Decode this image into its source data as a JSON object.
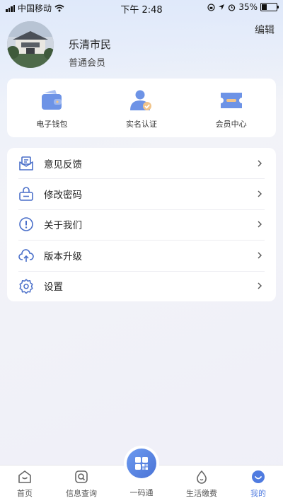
{
  "status_bar": {
    "carrier": "中国移动",
    "time": "下午 2:48",
    "battery": "35%",
    "battery_level": 0.35
  },
  "profile": {
    "edit_label": "编辑",
    "name": "乐清市民",
    "level": "普通会员"
  },
  "quick_actions": [
    {
      "label": "电子钱包",
      "icon": "wallet-icon"
    },
    {
      "label": "实名认证",
      "icon": "verified-user-icon"
    },
    {
      "label": "会员中心",
      "icon": "membership-card-icon"
    }
  ],
  "menu": [
    {
      "label": "意见反馈",
      "icon": "feedback-icon"
    },
    {
      "label": "修改密码",
      "icon": "lock-icon"
    },
    {
      "label": "关于我们",
      "icon": "info-icon"
    },
    {
      "label": "版本升级",
      "icon": "cloud-upload-icon"
    },
    {
      "label": "设置",
      "icon": "gear-icon"
    }
  ],
  "tabs": [
    {
      "label": "首页",
      "icon": "home-icon"
    },
    {
      "label": "信息查询",
      "icon": "search-icon"
    },
    {
      "label": "一码通",
      "icon": "qr-code-icon"
    },
    {
      "label": "生活缴费",
      "icon": "water-drop-icon"
    },
    {
      "label": "我的",
      "icon": "smile-user-icon",
      "active": true
    }
  ],
  "colors": {
    "accent": "#4f7be0",
    "page_bg": "#efeff8"
  }
}
